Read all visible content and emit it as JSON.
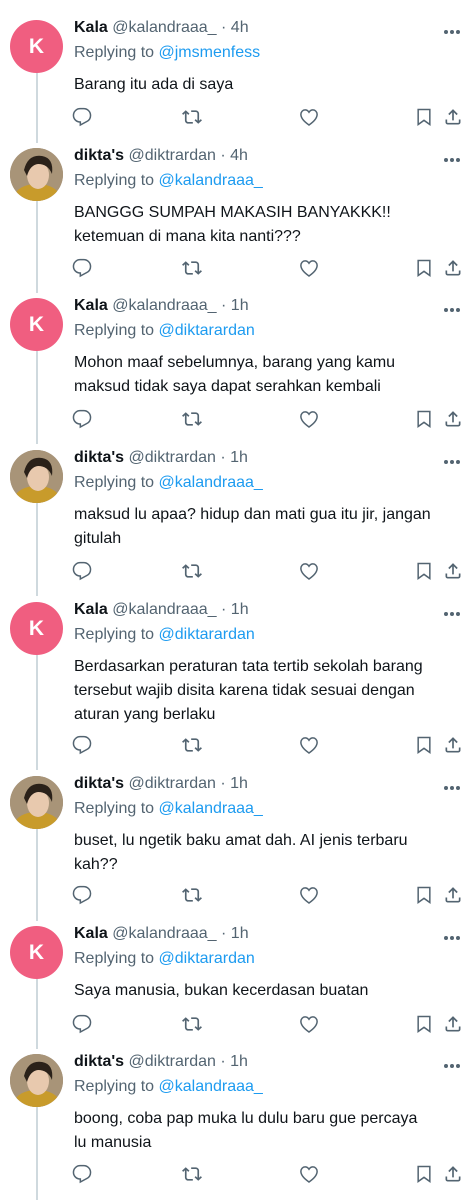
{
  "icons": {
    "more": "more-icon",
    "reply": "reply-icon",
    "retweet": "retweet-icon",
    "like": "like-icon",
    "bookmark": "bookmark-icon",
    "share": "share-icon"
  },
  "colors": {
    "accent": "#1d9bf0",
    "avatar_k": "#f05e80",
    "muted": "#536471",
    "text": "#0f1419"
  },
  "tweets": [
    {
      "avatar": "K",
      "name": "Kala",
      "handle": "@kalandraaa_",
      "dot": "·",
      "time": "4h",
      "replying": "Replying to",
      "mention": "@jmsmenfess",
      "lines": [
        "Barang itu ada di saya"
      ]
    },
    {
      "avatar": "",
      "name": "dikta's",
      "handle": "@diktrardan",
      "dot": "·",
      "time": "4h",
      "replying": "Replying to",
      "mention": "@kalandraaa_",
      "lines": [
        "BANGGG SUMPAH MAKASIH BANYAKKK!!",
        "ketemuan di mana kita nanti???"
      ]
    },
    {
      "avatar": "K",
      "name": "Kala",
      "handle": "@kalandraaa_",
      "dot": "·",
      "time": "1h",
      "replying": "Replying to",
      "mention": "@diktarardan",
      "lines": [
        "Mohon maaf sebelumnya, barang yang kamu",
        "maksud tidak saya dapat serahkan kembali"
      ]
    },
    {
      "avatar": "",
      "name": "dikta's",
      "handle": "@diktrardan",
      "dot": "·",
      "time": "1h",
      "replying": "Replying to",
      "mention": "@kalandraaa_",
      "lines": [
        "maksud lu apaa? hidup dan mati gua itu jir, jangan",
        "gitulah"
      ]
    },
    {
      "avatar": "K",
      "name": "Kala",
      "handle": "@kalandraaa_",
      "dot": "·",
      "time": "1h",
      "replying": "Replying to",
      "mention": "@diktarardan",
      "lines": [
        "Berdasarkan peraturan tata tertib sekolah barang",
        "tersebut wajib disita karena tidak sesuai dengan",
        "aturan yang berlaku"
      ]
    },
    {
      "avatar": "",
      "name": "dikta's",
      "handle": "@diktrardan",
      "dot": "·",
      "time": "1h",
      "replying": "Replying to",
      "mention": "@kalandraaa_",
      "lines": [
        "buset, lu ngetik baku amat dah. AI jenis terbaru",
        "kah??"
      ]
    },
    {
      "avatar": "K",
      "name": "Kala",
      "handle": "@kalandraaa_",
      "dot": "·",
      "time": "1h",
      "replying": "Replying to",
      "mention": "@diktarardan",
      "lines": [
        "Saya manusia, bukan kecerdasan buatan"
      ]
    },
    {
      "avatar": "",
      "name": "dikta's",
      "handle": "@diktrardan",
      "dot": "·",
      "time": "1h",
      "replying": "Replying to",
      "mention": "@kalandraaa_",
      "lines": [
        "boong, coba pap muka lu dulu baru gue percaya",
        "lu manusia"
      ]
    }
  ]
}
